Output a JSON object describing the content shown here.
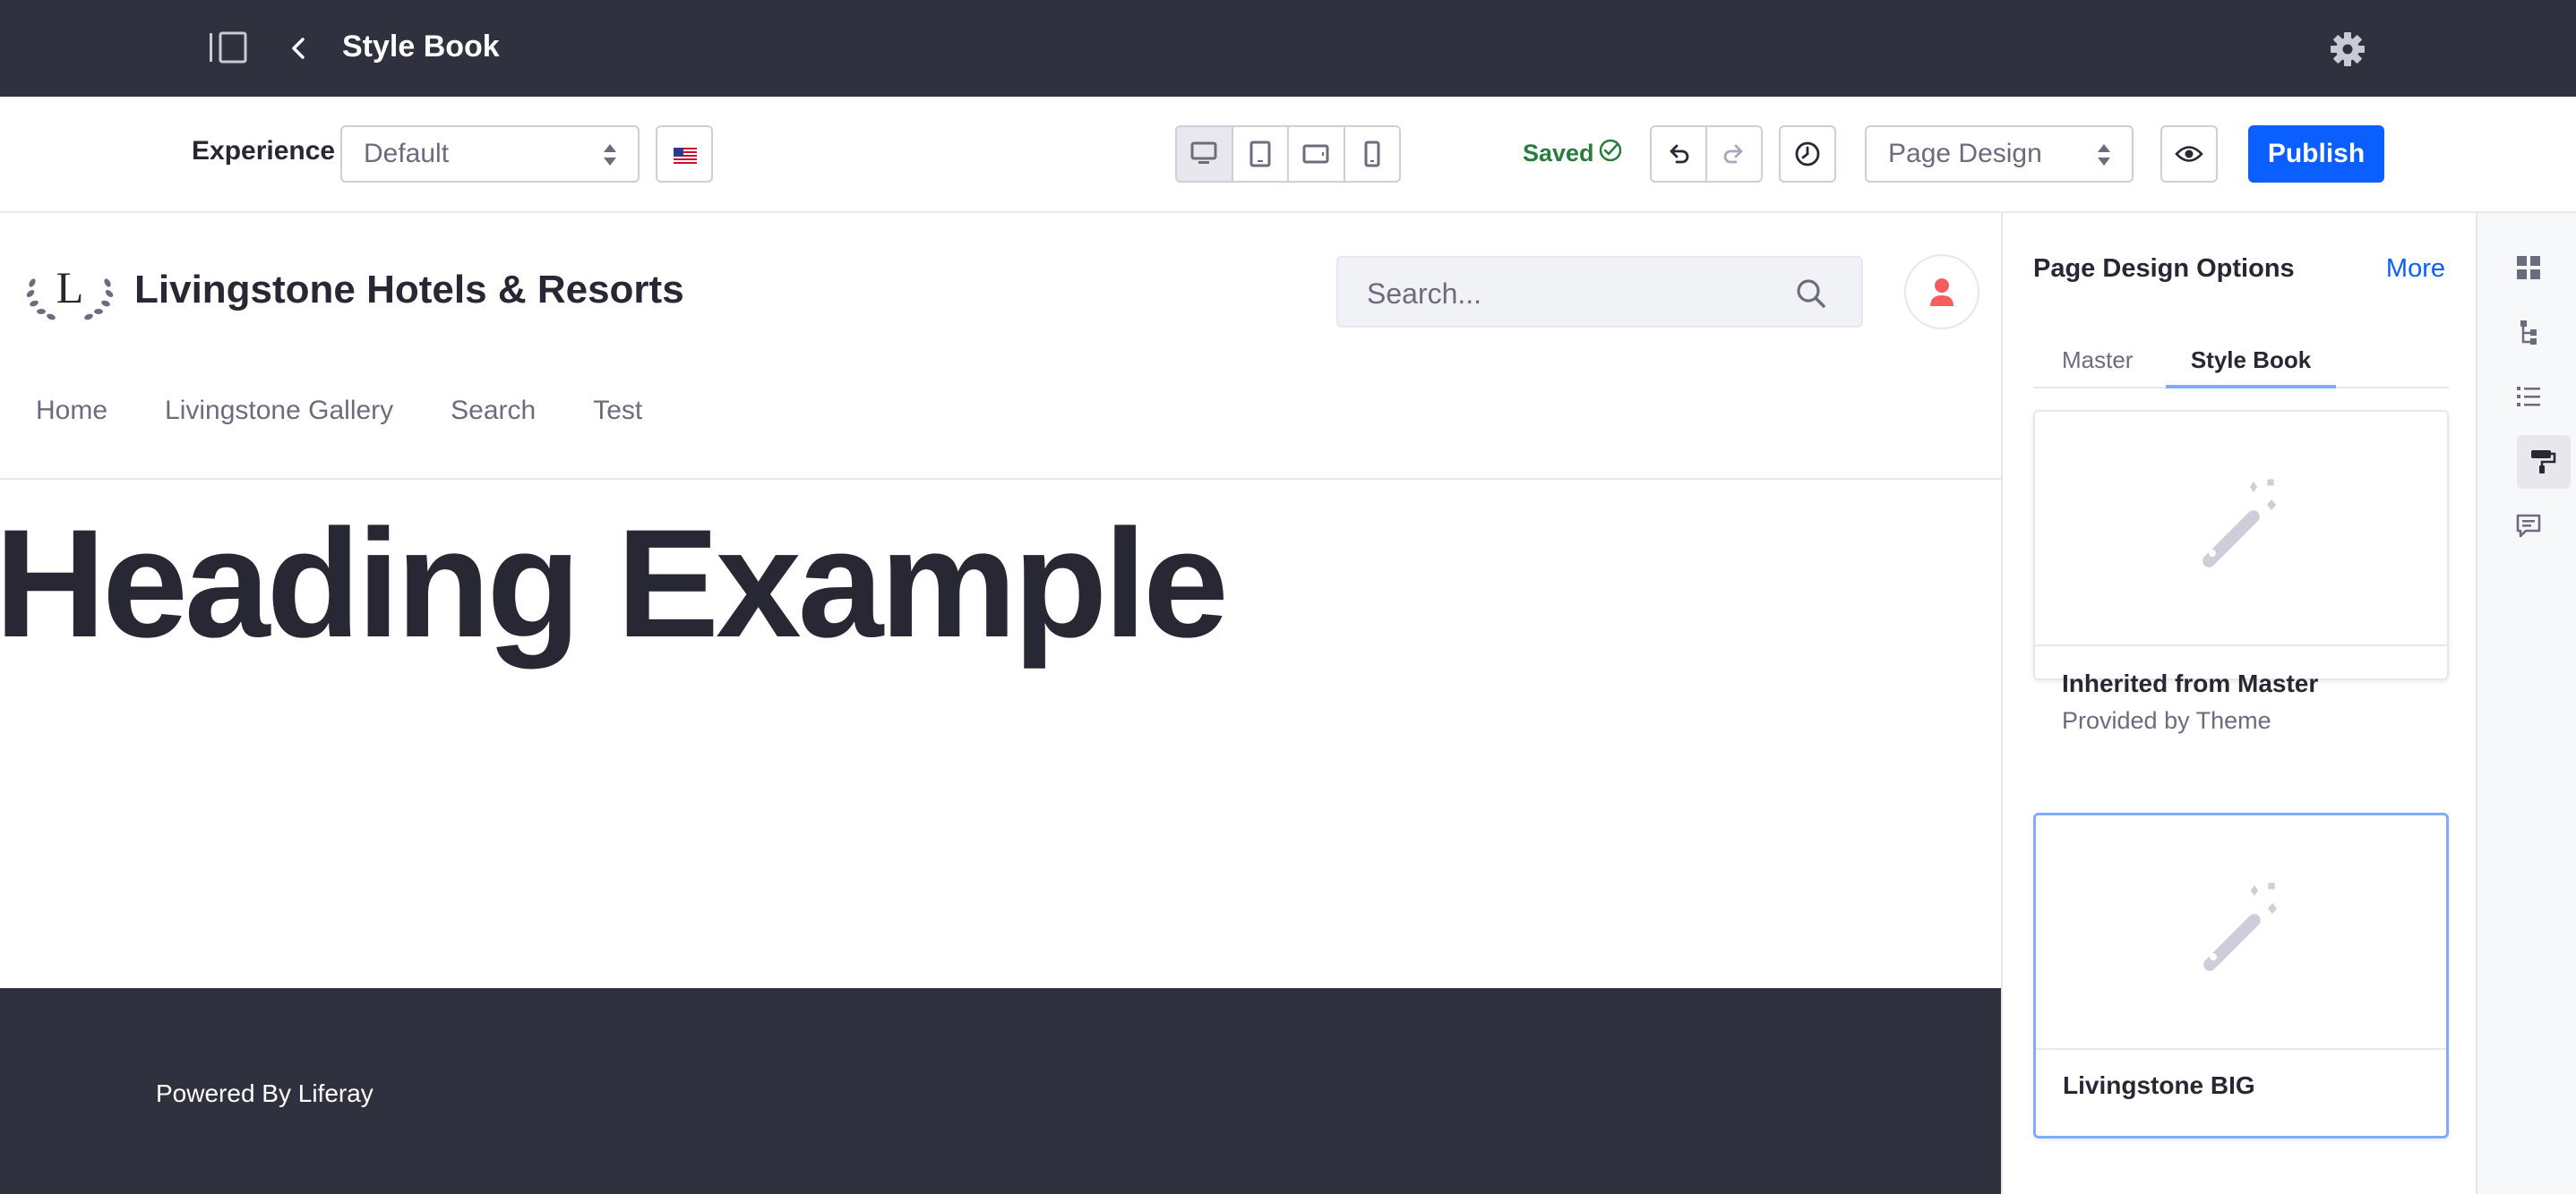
{
  "topbar": {
    "title": "Style Book",
    "icons": [
      "panel-toggle-icon",
      "chevron-left-icon",
      "gear-icon"
    ]
  },
  "toolbar": {
    "experience_label": "Experience",
    "experience_value": "Default",
    "language_icon": "us-flag-icon",
    "device_icons": [
      "desktop-icon",
      "tablet-icon",
      "landscape-phone-icon",
      "portrait-phone-icon"
    ],
    "saved_label": "Saved",
    "mode_value": "Page Design",
    "publish_label": "Publish"
  },
  "site": {
    "logo_letter": "L",
    "name": "Livingstone Hotels & Resorts",
    "search_placeholder": "Search...",
    "nav": [
      "Home",
      "Livingstone Gallery",
      "Search",
      "Test"
    ],
    "heading": "Heading Example",
    "footer": "Powered By Liferay"
  },
  "panel": {
    "title": "Page Design Options",
    "more": "More",
    "tabs": [
      "Master",
      "Style Book"
    ],
    "cards": [
      {
        "title": "Inherited from Master",
        "subtitle": "Provided by Theme"
      },
      {
        "title": "Livingstone BIG"
      }
    ]
  },
  "sidebar": {
    "icons": [
      "fragments-icon",
      "page-structure-icon",
      "list-icon",
      "paint-roller-icon",
      "comments-icon"
    ]
  },
  "colors": {
    "topbar_bg": "#30313f",
    "primary": "#0b5fff",
    "saved": "#287d3c",
    "avatar": "#f55e5e"
  }
}
